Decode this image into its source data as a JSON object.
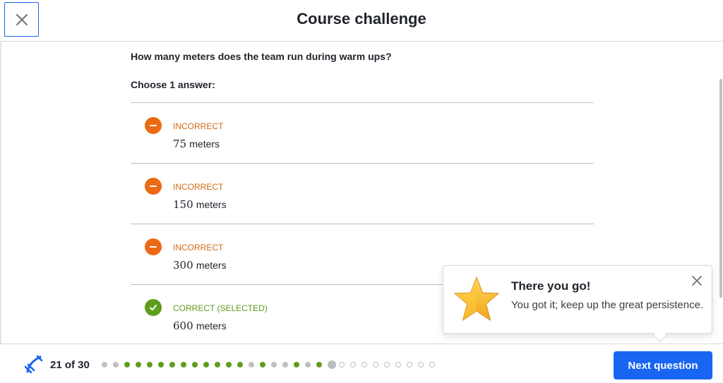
{
  "header": {
    "title": "Course challenge",
    "close_icon": "close-icon"
  },
  "question": {
    "prompt": "How many meters does the team run during warm ups?",
    "instruction": "Choose 1 answer:"
  },
  "answers": [
    {
      "status": "INCORRECT",
      "value": "75",
      "unit": "meters",
      "state": "incorrect",
      "icon": "minus-circle-icon"
    },
    {
      "status": "INCORRECT",
      "value": "150",
      "unit": "meters",
      "state": "incorrect",
      "icon": "minus-circle-icon"
    },
    {
      "status": "INCORRECT",
      "value": "300",
      "unit": "meters",
      "state": "incorrect",
      "icon": "minus-circle-icon"
    },
    {
      "status": "CORRECT (SELECTED)",
      "value": "600",
      "unit": "meters",
      "state": "correct",
      "icon": "check-circle-icon"
    }
  ],
  "toast": {
    "title": "There you go!",
    "message": "You got it; keep up the great persistence.",
    "icon": "star-icon"
  },
  "footer": {
    "progress_label": "21 of 30",
    "current": 21,
    "total": 30,
    "dot_states": [
      "gray",
      "gray",
      "green",
      "green",
      "green",
      "green",
      "green",
      "green",
      "green",
      "green",
      "green",
      "green",
      "green",
      "gray",
      "green",
      "gray",
      "gray",
      "green",
      "gray",
      "green",
      "current",
      "empty",
      "empty",
      "empty",
      "empty",
      "empty",
      "empty",
      "empty",
      "empty",
      "empty"
    ],
    "next_label": "Next question"
  },
  "colors": {
    "accent": "#1865f2",
    "correct": "#5e9d1c",
    "incorrect": "#ec6a14",
    "dot_gray": "#bdbfc3",
    "dot_green": "#5e9d1c",
    "dot_current": "#babec2"
  }
}
